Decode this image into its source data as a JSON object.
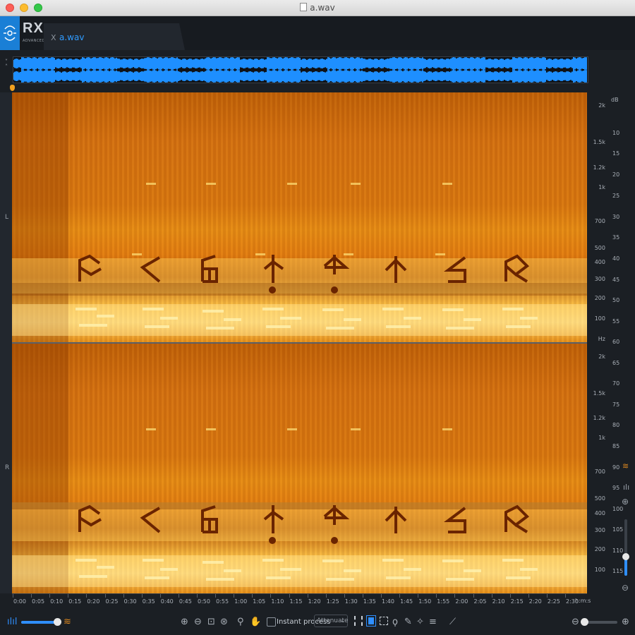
{
  "window": {
    "title": "a.wav"
  },
  "app": {
    "logo_text": "RX",
    "edition": "ADVANCED"
  },
  "tab": {
    "close_glyph": "X",
    "label": "a.wav"
  },
  "channels": {
    "left": "L",
    "right": "R"
  },
  "freq_scale": {
    "unit": "Hz",
    "left_ticks": [
      "2k",
      "1.5k",
      "1.2k",
      "1k",
      "700",
      "500",
      "400",
      "300",
      "200",
      "100"
    ],
    "right_ticks": [
      "2k",
      "1.5k",
      "1.2k",
      "1k",
      "700",
      "500",
      "400",
      "300",
      "200",
      "100"
    ]
  },
  "db_scale": {
    "unit": "dB",
    "ticks": [
      "10",
      "15",
      "20",
      "25",
      "30",
      "35",
      "40",
      "45",
      "50",
      "55",
      "60",
      "65",
      "70",
      "75",
      "80",
      "85",
      "90",
      "95",
      "100",
      "105",
      "110",
      "115"
    ]
  },
  "time_ruler": {
    "ticks": [
      "0:00",
      "0:05",
      "0:10",
      "0:15",
      "0:20",
      "0:25",
      "0:30",
      "0:35",
      "0:40",
      "0:45",
      "0:50",
      "0:55",
      "1:00",
      "1:05",
      "1:10",
      "1:15",
      "1:20",
      "1:25",
      "1:30",
      "1:35",
      "1:40",
      "1:45",
      "1:50",
      "1:55",
      "2:00",
      "2:05",
      "2:10",
      "2:15",
      "2:20",
      "2:25",
      "2:30"
    ],
    "unit": "h:m:s"
  },
  "toolbar": {
    "instant_process_label": "Instant process",
    "mode_select": "Attenuate",
    "icons": [
      "waveform-icon",
      "spectrogram-icon",
      "zoom-in-icon",
      "zoom-out-icon",
      "zoom-selection-icon",
      "zoom-fit-icon",
      "magnify-icon",
      "hand-icon",
      "time-select-icon",
      "freq-select-icon",
      "rect-select-icon",
      "lasso-icon",
      "brush-icon",
      "magic-wand-icon",
      "harmonic-icon",
      "pen-icon"
    ]
  },
  "colors": {
    "accent": "#2f8fff",
    "spectrogram_hot": "#ffd975",
    "spectrogram_mid": "#e07810"
  }
}
